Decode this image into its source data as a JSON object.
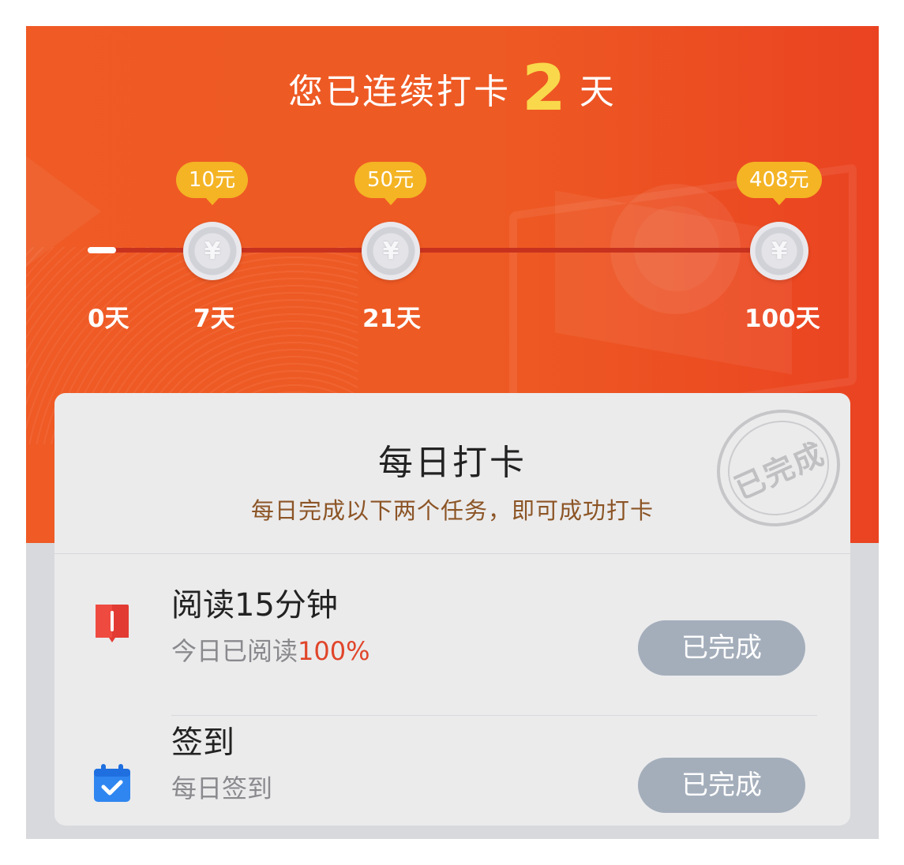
{
  "header": {
    "title_prefix": "您已连续打卡",
    "streak_days": "2",
    "title_suffix": "天"
  },
  "milestones": {
    "start_label": "0天",
    "progress_fraction": 0.02,
    "items": [
      {
        "reward": "10元",
        "day_label": "7天",
        "coin_symbol": "¥"
      },
      {
        "reward": "50元",
        "day_label": "21天",
        "coin_symbol": "¥"
      },
      {
        "reward": "408元",
        "day_label": "100天",
        "coin_symbol": "¥"
      }
    ]
  },
  "card": {
    "title": "每日打卡",
    "subtitle": "每日完成以下两个任务，即可成功打卡",
    "stamp_text": "已完成",
    "tasks": [
      {
        "title": "阅读15分钟",
        "subtitle_prefix": "今日已阅读",
        "subtitle_highlight": "100%",
        "button_label": "已完成",
        "icon": "book-icon"
      },
      {
        "title": "签到",
        "subtitle_prefix": "每日签到",
        "subtitle_highlight": "",
        "button_label": "已完成",
        "icon": "calendar-check-icon"
      }
    ]
  },
  "colors": {
    "hero_orange": "#ee5a23",
    "accent_yellow": "#f9d84b",
    "reward_badge": "#f4b424",
    "highlight_red": "#e0452a",
    "button_grey": "#a4aebb"
  }
}
